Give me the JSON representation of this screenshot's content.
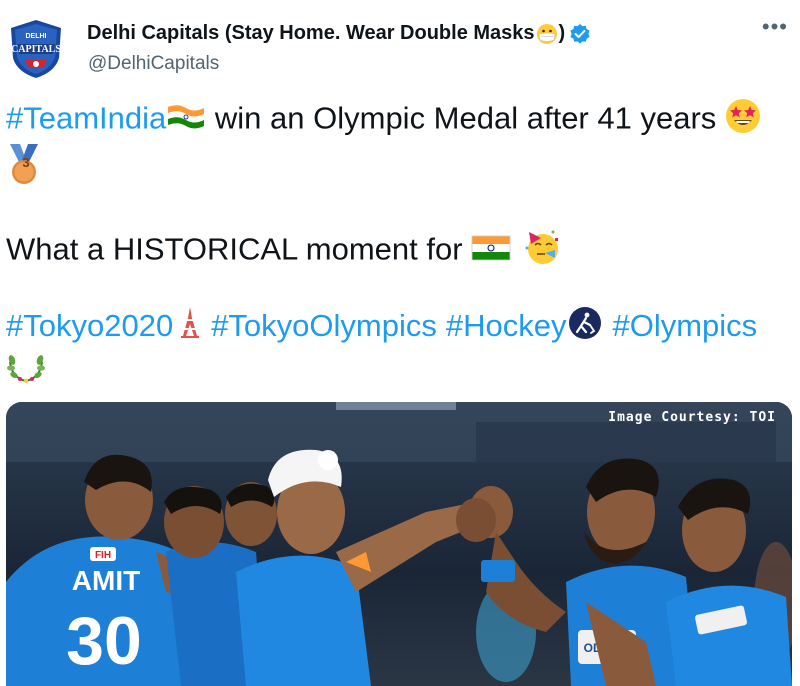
{
  "tweet": {
    "display_name": "Delhi Capitals (Stay Home. Wear Double Masks",
    "display_name_close": ")",
    "handle": "@DelhiCapitals",
    "more_label": "•••",
    "avatar_text_top": "DELHI",
    "avatar_text_main": "CAPITALS",
    "lines": {
      "l1_hashtag": "#TeamIndia",
      "l1_text": " win an Olympic Medal after 41 years ",
      "medal_number": "3",
      "l3_text": "What a HISTORICAL moment for ",
      "tag_tokyo2020": "#Tokyo2020",
      "tag_tokyoolympics": "#TokyoOlympics",
      "tag_hockey": "#Hockey",
      "tag_olympics": "#Olympics"
    }
  },
  "media": {
    "courtesy": "Image Courtesy: TOI",
    "jersey_name": "AMIT",
    "jersey_number": "30",
    "jersey_sponsor": "ODISHA",
    "fih_badge": "FIH"
  },
  "colors": {
    "link": "#1d9bf0",
    "text": "#0f1419",
    "muted": "#536471",
    "brand_blue": "#1d4f91",
    "jersey_blue": "#1e7fd6"
  }
}
